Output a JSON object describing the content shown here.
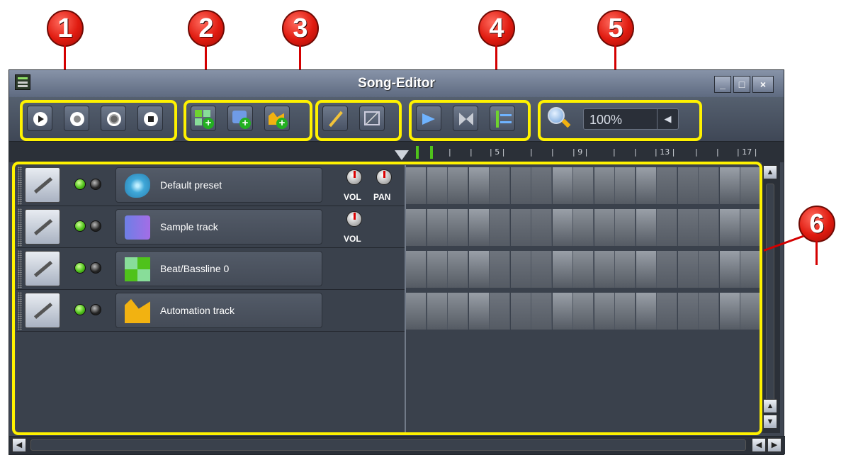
{
  "callouts": [
    "1",
    "2",
    "3",
    "4",
    "5",
    "6"
  ],
  "window": {
    "title": "Song-Editor",
    "controls": {
      "minimize": "_",
      "maximize": "□",
      "close": "×"
    }
  },
  "toolbar": {
    "playback": [
      "play-icon",
      "record-icon",
      "record-while-playing-icon",
      "stop-icon"
    ],
    "add": [
      "add-beat-bassline-icon",
      "add-sample-track-icon",
      "add-automation-track-icon"
    ],
    "edit_modes": [
      "draw-mode-icon",
      "edit-mode-icon"
    ],
    "utility": [
      "arrow-right-icon",
      "bowtie-icon",
      "swap-lines-icon"
    ],
    "zoom": {
      "icon": "magnifier-icon",
      "value": "100%"
    }
  },
  "ruler": {
    "labels": [
      "5",
      "9",
      "13",
      "17"
    ]
  },
  "tracks": [
    {
      "name": "Default preset",
      "icon": "instrument-icon",
      "knobs": [
        "VOL",
        "PAN"
      ]
    },
    {
      "name": "Sample track",
      "icon": "sample-icon",
      "knobs": [
        "VOL"
      ]
    },
    {
      "name": "Beat/Bassline 0",
      "icon": "beat-bassline-icon",
      "knobs": []
    },
    {
      "name": "Automation track",
      "icon": "automation-icon",
      "knobs": []
    }
  ],
  "colors": {
    "highlight": "#fff200",
    "callout": "#e01b10",
    "window_bg": "#3f4652",
    "led_on": "#4fc21b"
  }
}
